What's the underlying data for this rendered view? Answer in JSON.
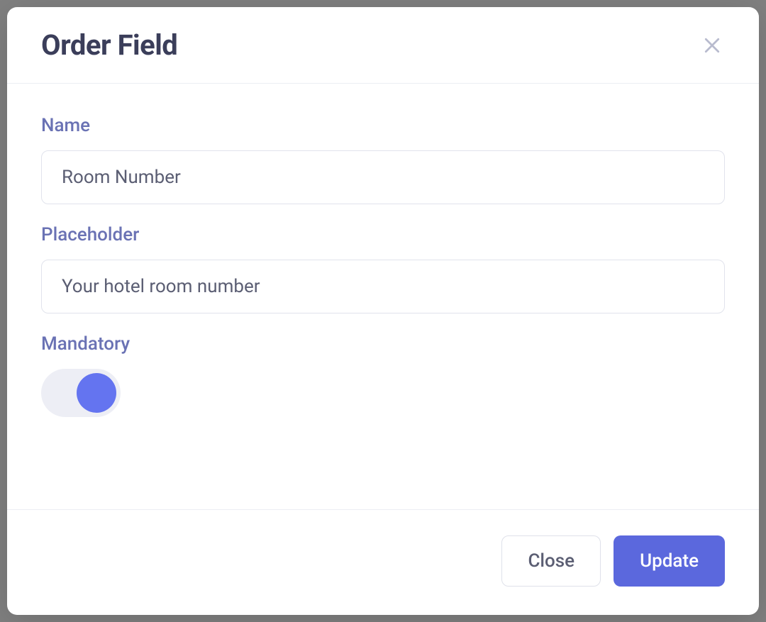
{
  "modal": {
    "title": "Order Field",
    "close_aria": "Close",
    "fields": {
      "name": {
        "label": "Name",
        "value": "Room Number"
      },
      "placeholder": {
        "label": "Placeholder",
        "value": "Your hotel room number"
      },
      "mandatory": {
        "label": "Mandatory",
        "enabled": true
      }
    },
    "footer": {
      "close_label": "Close",
      "update_label": "Update"
    }
  }
}
